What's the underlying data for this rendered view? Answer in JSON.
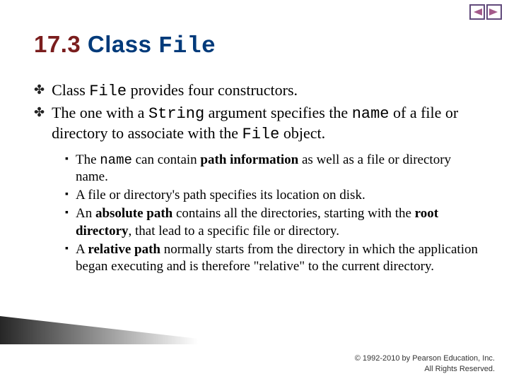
{
  "title": {
    "num": "17.3",
    "word": "Class",
    "code": "File"
  },
  "main_items": [
    {
      "parts": [
        {
          "t": "Class ",
          "cls": ""
        },
        {
          "t": "File",
          "cls": "code"
        },
        {
          "t": " provides four constructors.",
          "cls": ""
        }
      ]
    },
    {
      "parts": [
        {
          "t": "The one with a ",
          "cls": ""
        },
        {
          "t": "String",
          "cls": "code"
        },
        {
          "t": " argument specifies the ",
          "cls": ""
        },
        {
          "t": "name",
          "cls": "code"
        },
        {
          "t": " of a file or directory to associate with the ",
          "cls": ""
        },
        {
          "t": "File",
          "cls": "code"
        },
        {
          "t": " object.",
          "cls": ""
        }
      ]
    }
  ],
  "sub_items": [
    {
      "parts": [
        {
          "t": "The ",
          "cls": ""
        },
        {
          "t": "name",
          "cls": "code"
        },
        {
          "t": " can contain ",
          "cls": ""
        },
        {
          "t": "path information",
          "cls": "bold"
        },
        {
          "t": " as well as a file or directory name.",
          "cls": ""
        }
      ]
    },
    {
      "parts": [
        {
          "t": "A file or directory's path specifies its location on disk.",
          "cls": ""
        }
      ]
    },
    {
      "parts": [
        {
          "t": "An ",
          "cls": ""
        },
        {
          "t": "absolute path",
          "cls": "bold"
        },
        {
          "t": " contains all the directories, starting with the ",
          "cls": ""
        },
        {
          "t": "root directory",
          "cls": "bold"
        },
        {
          "t": ", that lead to a specific file or directory.",
          "cls": ""
        }
      ]
    },
    {
      "parts": [
        {
          "t": "A ",
          "cls": ""
        },
        {
          "t": "relative path",
          "cls": "bold"
        },
        {
          "t": " normally starts from the directory in which the application began executing and is therefore \"relative\" to the current directory.",
          "cls": ""
        }
      ]
    }
  ],
  "footer": {
    "line1": "© 1992-2010 by Pearson Education, Inc.",
    "line2": "All Rights Reserved."
  }
}
